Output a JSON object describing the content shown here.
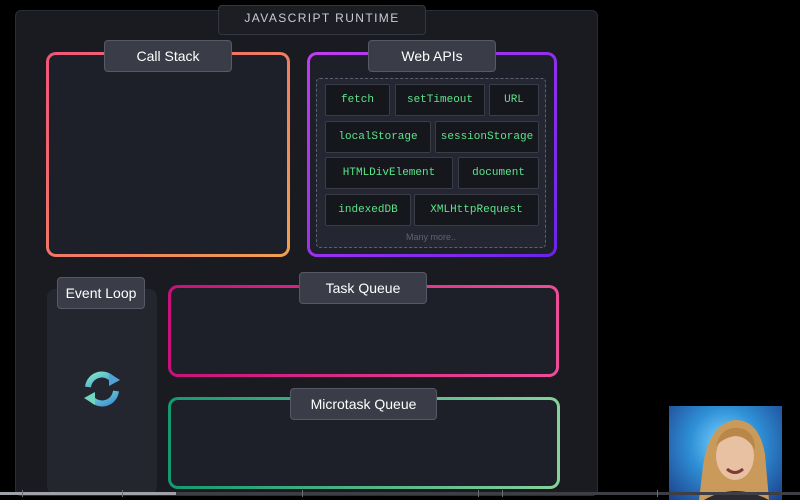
{
  "runtime": {
    "title": "JAVASCRIPT RUNTIME"
  },
  "call_stack": {
    "label": "Call Stack"
  },
  "web_apis": {
    "label": "Web APIs",
    "items": [
      "fetch",
      "setTimeout",
      "URL",
      "localStorage",
      "sessionStorage",
      "HTMLDivElement",
      "document",
      "indexedDB",
      "XMLHttpRequest"
    ],
    "more": "Many more.."
  },
  "event_loop": {
    "label": "Event Loop",
    "icon": "refresh-icon"
  },
  "task_queue": {
    "label": "Task Queue"
  },
  "microtask_queue": {
    "label": "Microtask Queue"
  },
  "video": {
    "progress_fraction": 0.22
  },
  "colors": {
    "call_stack_border": [
      "#f0557a",
      "#f0a050"
    ],
    "web_apis_border": [
      "#c23cf2",
      "#6a24ea"
    ],
    "task_queue_border": [
      "#c8117a",
      "#ee4c98"
    ],
    "microtask_queue_border": [
      "#149a70",
      "#86d29b"
    ],
    "chip_text": "#5de38a"
  }
}
